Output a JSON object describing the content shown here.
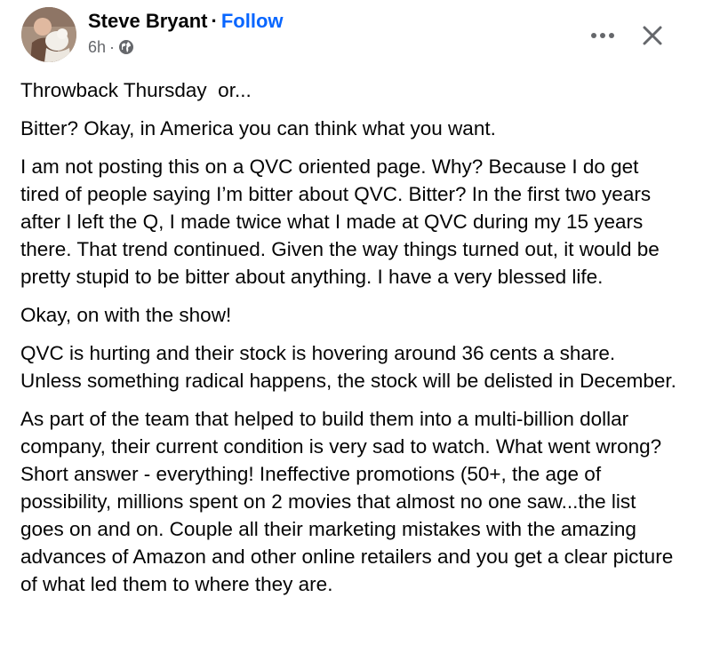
{
  "post": {
    "author": "Steve Bryant",
    "separator": "·",
    "follow_label": "Follow",
    "time": "6h",
    "meta_separator": "·",
    "privacy_icon": "globe-icon",
    "more_icon": "more-options-icon",
    "close_icon": "close-icon",
    "paragraphs": [
      "Throwback Thursday  or...",
      "Bitter? Okay, in America you can think what you want.",
      "I am not posting this on a QVC oriented page. Why? Because I do get tired of people saying I’m bitter about QVC. Bitter? In the first two years after I left the Q, I made twice what I made at QVC during my 15 years there. That trend continued. Given the way things turned out, it would be pretty stupid to be bitter about anything. I have a very blessed life.",
      "Okay, on with the show!",
      "QVC is hurting and their stock is hovering around 36 cents a share. Unless something radical happens, the stock will be delisted in December.",
      "As part of the team that helped to build them into a multi-billion dollar company, their current condition is very sad to watch. What went wrong? Short answer - everything! Ineffective promotions (50+, the age of possibility, millions spent on 2 movies that almost no one saw...the list goes on and on. Couple all their marketing mistakes with the amazing advances of Amazon and other online retailers and you get a clear picture of what led them to where they are."
    ]
  },
  "colors": {
    "follow": "#0866ff",
    "meta": "#65676b",
    "text": "#050505"
  }
}
